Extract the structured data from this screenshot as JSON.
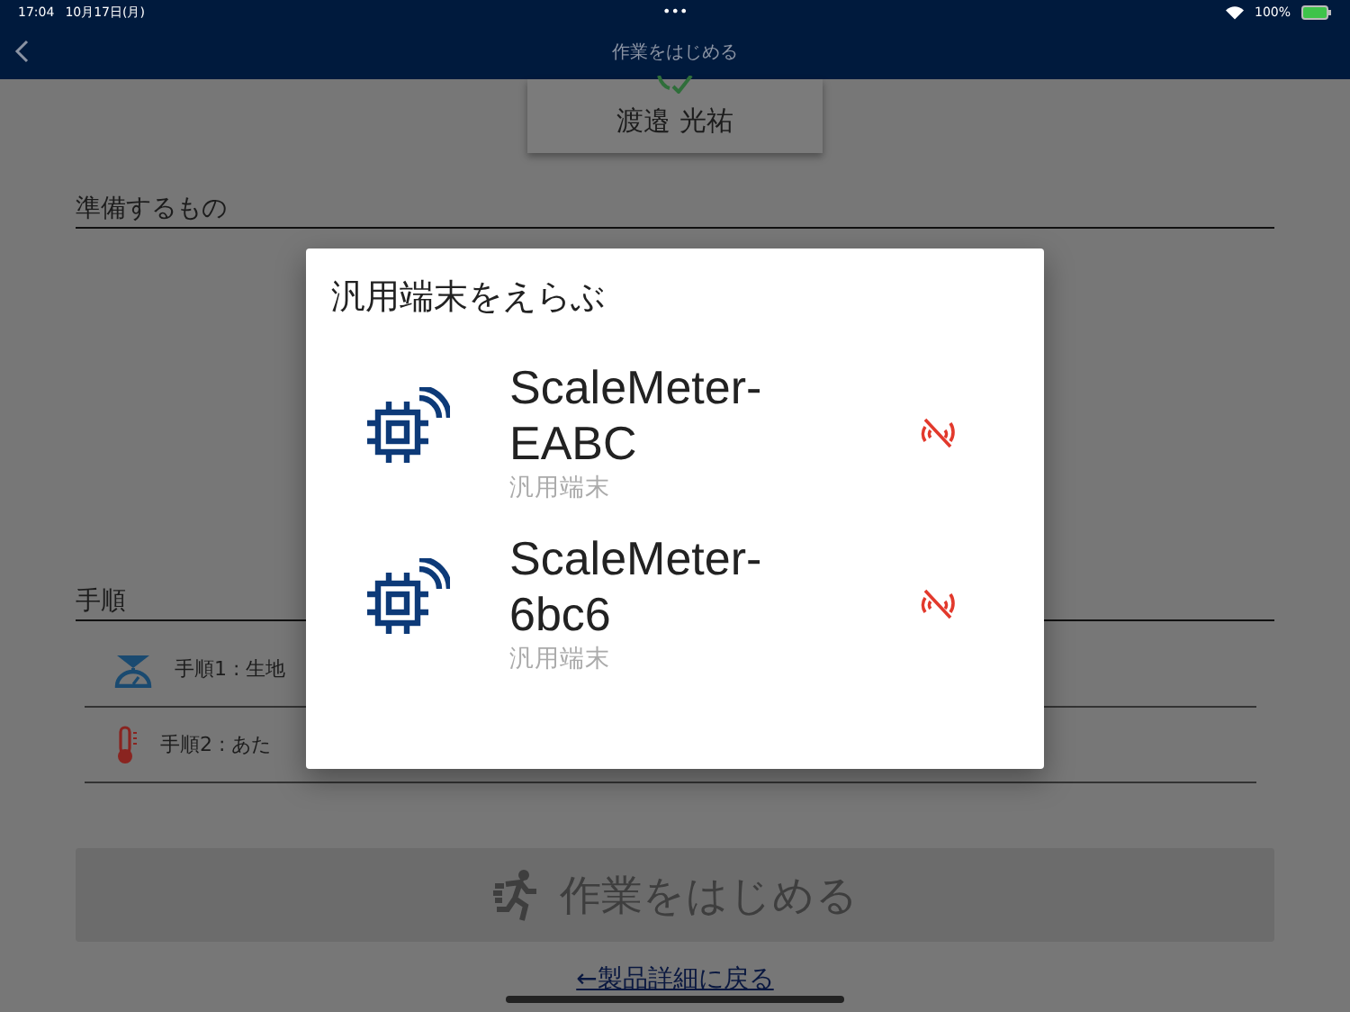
{
  "status_bar": {
    "time": "17:04",
    "date": "10月17日(月)",
    "dots": "•••",
    "battery": "100%"
  },
  "nav": {
    "title": "作業をはじめる"
  },
  "worker": {
    "name": "渡邉 光祐"
  },
  "sections": {
    "items_heading": "準備するもの",
    "steps_heading": "手順"
  },
  "steps": [
    {
      "kind": "scale",
      "label": "手順1 : 生地"
    },
    {
      "kind": "thermometer",
      "label": "手順2 : あた"
    }
  ],
  "start_button": {
    "label": "作業をはじめる",
    "disabled": true
  },
  "back_link": "←製品詳細に戻る",
  "dialog": {
    "title": "汎用端末をえらぶ",
    "devices": [
      {
        "name": "ScaleMeter-EABC",
        "subtitle": "汎用端末",
        "connected": false
      },
      {
        "name": "ScaleMeter-6bc6",
        "subtitle": "汎用端末",
        "connected": false
      }
    ]
  }
}
